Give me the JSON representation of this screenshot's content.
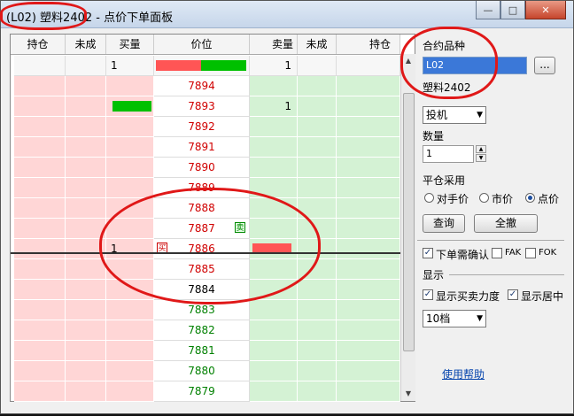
{
  "window": {
    "title": "(L02) 塑料2402 - 点价下单面板",
    "minimize_label": "—",
    "maximize_label": "□",
    "close_label": "✕"
  },
  "grid": {
    "headers": [
      "持仓",
      "未成",
      "买量",
      "价位",
      "卖量",
      "未成",
      "持仓"
    ],
    "summary_row": {
      "buy_volume": "1",
      "sell_volume": "1"
    },
    "rows": [
      {
        "price": "7894",
        "color": "red",
        "sell_volume": "",
        "buy_volume": "",
        "buy_bar": false,
        "sell_bar": false,
        "sell_tag": "",
        "buy_tag": ""
      },
      {
        "price": "7893",
        "color": "red",
        "sell_volume": "1",
        "buy_volume": "",
        "buy_bar": true,
        "sell_bar": false,
        "sell_tag": "",
        "buy_tag": ""
      },
      {
        "price": "7892",
        "color": "red",
        "sell_volume": "",
        "buy_volume": "",
        "buy_bar": false,
        "sell_bar": false,
        "sell_tag": "",
        "buy_tag": ""
      },
      {
        "price": "7891",
        "color": "red",
        "sell_volume": "",
        "buy_volume": "",
        "buy_bar": false,
        "sell_bar": false,
        "sell_tag": "",
        "buy_tag": ""
      },
      {
        "price": "7890",
        "color": "red",
        "sell_volume": "",
        "buy_volume": "",
        "buy_bar": false,
        "sell_bar": false,
        "sell_tag": "",
        "buy_tag": ""
      },
      {
        "price": "7889",
        "color": "red",
        "sell_volume": "",
        "buy_volume": "",
        "buy_bar": false,
        "sell_bar": false,
        "sell_tag": "",
        "buy_tag": ""
      },
      {
        "price": "7888",
        "color": "red",
        "sell_volume": "",
        "buy_volume": "",
        "buy_bar": false,
        "sell_bar": false,
        "sell_tag": "",
        "buy_tag": ""
      },
      {
        "price": "7887",
        "color": "red",
        "sell_volume": "",
        "buy_volume": "",
        "buy_bar": false,
        "sell_bar": false,
        "sell_tag": "卖",
        "buy_tag": ""
      },
      {
        "price": "7886",
        "color": "red",
        "sell_volume": "",
        "buy_volume": "1",
        "buy_bar": false,
        "sell_bar": true,
        "sell_tag": "",
        "buy_tag": "买"
      },
      {
        "price": "7885",
        "color": "red",
        "sell_volume": "",
        "buy_volume": "",
        "buy_bar": false,
        "sell_bar": false,
        "sell_tag": "",
        "buy_tag": ""
      },
      {
        "price": "7884",
        "color": "black",
        "sell_volume": "",
        "buy_volume": "",
        "buy_bar": false,
        "sell_bar": false,
        "sell_tag": "",
        "buy_tag": ""
      },
      {
        "price": "7883",
        "color": "green",
        "sell_volume": "",
        "buy_volume": "",
        "buy_bar": false,
        "sell_bar": false,
        "sell_tag": "",
        "buy_tag": ""
      },
      {
        "price": "7882",
        "color": "green",
        "sell_volume": "",
        "buy_volume": "",
        "buy_bar": false,
        "sell_bar": false,
        "sell_tag": "",
        "buy_tag": ""
      },
      {
        "price": "7881",
        "color": "green",
        "sell_volume": "",
        "buy_volume": "",
        "buy_bar": false,
        "sell_bar": false,
        "sell_tag": "",
        "buy_tag": ""
      },
      {
        "price": "7880",
        "color": "green",
        "sell_volume": "",
        "buy_volume": "",
        "buy_bar": false,
        "sell_bar": false,
        "sell_tag": "",
        "buy_tag": ""
      },
      {
        "price": "7879",
        "color": "green",
        "sell_volume": "",
        "buy_volume": "",
        "buy_bar": false,
        "sell_bar": false,
        "sell_tag": "",
        "buy_tag": ""
      }
    ],
    "scroll_up_icon": "▲",
    "scroll_down_icon": "▼"
  },
  "panel": {
    "contract_label": "合约品种",
    "contract_code": "L02",
    "browse_label": "...",
    "contract_name": "塑料2402",
    "order_type": "投机",
    "quantity_label": "数量",
    "quantity_value": "1",
    "close_mode_label": "平仓采用",
    "close_options": [
      "对手价",
      "市价",
      "点价"
    ],
    "close_selected": "点价",
    "query_button": "查询",
    "cancel_all_button": "全撤",
    "confirm_label": "下单需确认",
    "fak_label": "FAK",
    "fok_label": "FOK",
    "display_label": "显示",
    "show_strength_label": "显示买卖力度",
    "show_center_label": "显示居中",
    "depth_value": "10档",
    "help_link": "使用帮助"
  },
  "colors": {
    "bid_bg": "#ffd6d6",
    "ask_bg": "#d4f2d4",
    "up_price": "#d00000",
    "down_price": "#008000",
    "annotation": "#e01818"
  }
}
